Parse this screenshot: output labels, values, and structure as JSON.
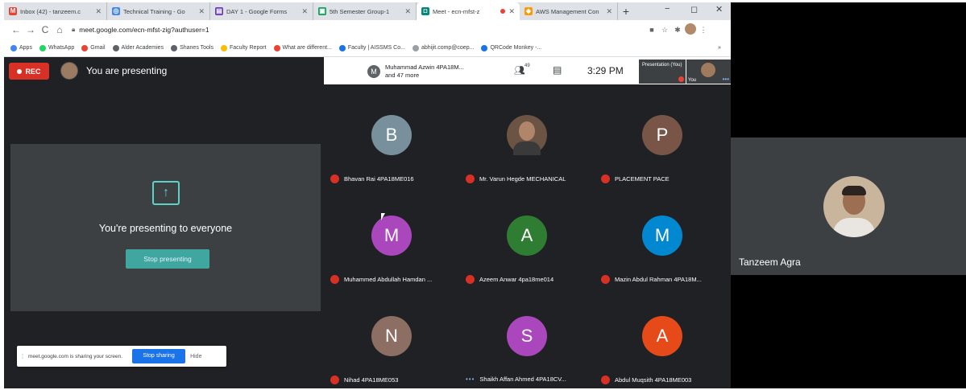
{
  "browser": {
    "tabs": [
      {
        "title": "Inbox (42) - tanzeem.c",
        "icon": "gmail-icon",
        "color": "#ea4335",
        "glyph": "M",
        "active": false
      },
      {
        "title": "Technical Training - Go",
        "icon": "drive-icon",
        "color": "#4285f4",
        "glyph": "◎",
        "active": false
      },
      {
        "title": "DAY 1 - Google Forms",
        "icon": "forms-icon",
        "color": "#673ab7",
        "glyph": "▤",
        "active": false
      },
      {
        "title": "5th Semester Group-1",
        "icon": "classroom-icon",
        "color": "#0f9d58",
        "glyph": "▣",
        "active": false
      },
      {
        "title": "Meet - ecn-mfst-z",
        "icon": "meet-icon",
        "color": "#00897b",
        "glyph": "◘",
        "active": true
      },
      {
        "title": "AWS Management Con",
        "icon": "aws-icon",
        "color": "#ff9900",
        "glyph": "◆",
        "active": false
      }
    ],
    "new_tab": "+",
    "window_controls": {
      "minimize": "−",
      "maximize": "◻",
      "close": "✕"
    },
    "url": "meet.google.com/ecn-mfst-zig?authuser=1",
    "bookmarks": [
      {
        "label": "Apps",
        "color": "#4285f4"
      },
      {
        "label": "WhatsApp",
        "color": "#25d366"
      },
      {
        "label": "Gmail",
        "color": "#ea4335"
      },
      {
        "label": "Alder Academies",
        "color": "#5f6368"
      },
      {
        "label": "Shanes Tools",
        "color": "#5f6368"
      },
      {
        "label": "Faculty Report",
        "color": "#fbbc04"
      },
      {
        "label": "What are different...",
        "color": "#ea4335"
      },
      {
        "label": "Faculty | AISSMS Co...",
        "color": "#1a73e8"
      },
      {
        "label": "abhijit.comp@coep...",
        "color": "#9aa0a6"
      },
      {
        "label": "QRCode Monkey -...",
        "color": "#1a73e8"
      }
    ],
    "bookmarks_more": "»"
  },
  "meet": {
    "rec_label": "REC",
    "presenting_label": "You are presenting",
    "panel": {
      "avatar_letter": "M",
      "participant_line1": "Muhammad Azwin 4PA18M...",
      "participant_line2": "and 47 more",
      "people_count": "49",
      "clock": "3:29 PM",
      "presentation_tile": "Presentation (You)",
      "self_label": "You"
    },
    "present": {
      "message": "You're presenting to everyone",
      "stop_button": "Stop presenting",
      "share_text": "meet.google.com is sharing your screen.",
      "stop_sharing": "Stop sharing",
      "hide": "Hide"
    },
    "participants": [
      {
        "letter": "B",
        "name": "Bhavan Rai 4PA18ME016",
        "color": "#78909c",
        "photo": false,
        "muted": true
      },
      {
        "letter": "",
        "name": "Mr. Varun Hegde MECHANICAL",
        "color": "#6b5443",
        "photo": true,
        "muted": true
      },
      {
        "letter": "P",
        "name": "PLACEMENT PACE",
        "color": "#795548",
        "photo": false,
        "muted": true
      },
      {
        "letter": "M",
        "name": "Muhammed Abdullah Hamdan ...",
        "color": "#ab47bc",
        "photo": false,
        "muted": true
      },
      {
        "letter": "A",
        "name": "Azeem Anwar 4pa18me014",
        "color": "#2e7d32",
        "photo": false,
        "muted": true
      },
      {
        "letter": "M",
        "name": "Mazin Abdul Rahman 4PA18M...",
        "color": "#0288d1",
        "photo": false,
        "muted": true
      },
      {
        "letter": "N",
        "name": "Nihad 4PA18ME053",
        "color": "#8d6e63",
        "photo": false,
        "muted": true
      },
      {
        "letter": "S",
        "name": "Shaikh Affan Ahmed 4PA18CV...",
        "color": "#ab47bc",
        "photo": false,
        "muted": false
      },
      {
        "letter": "A",
        "name": "Abdul Muqsith 4PA18ME003",
        "color": "#e64a19",
        "photo": false,
        "muted": true
      }
    ],
    "side_participant": {
      "name": "Tanzeem Agra"
    }
  }
}
